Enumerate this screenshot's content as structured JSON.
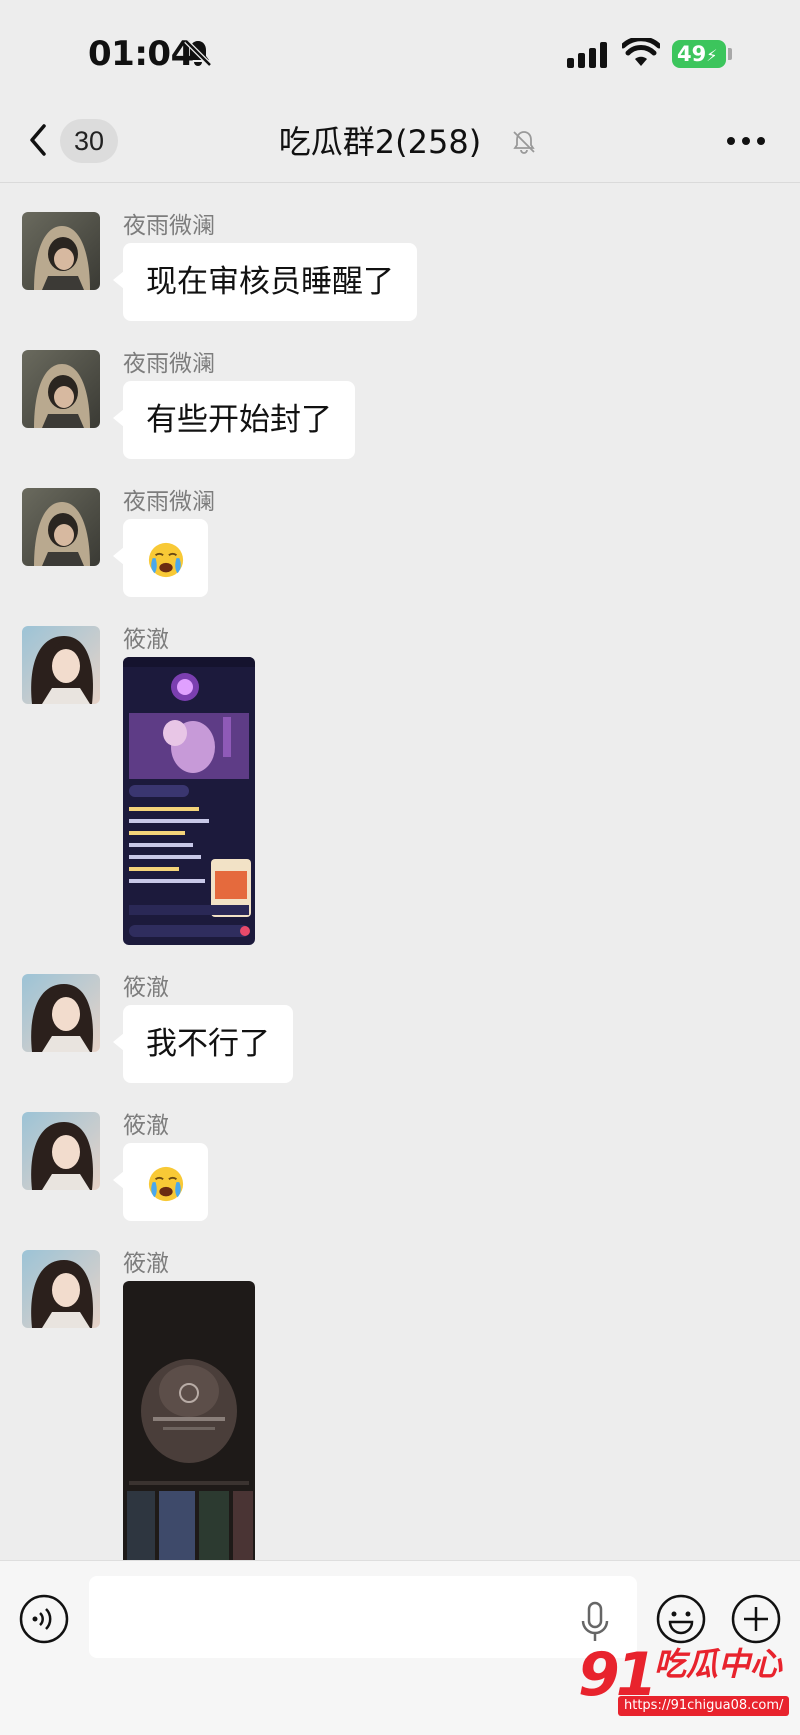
{
  "status_bar": {
    "time": "01:04",
    "battery": "49"
  },
  "header": {
    "back_count": "30",
    "title": "吃瓜群2(258)"
  },
  "messages": [
    {
      "sender": "夜雨微澜",
      "text": "现在审核员睡醒了"
    },
    {
      "sender": "夜雨微澜",
      "text": "有些开始封了"
    },
    {
      "sender": "夜雨微澜",
      "emoji": "😭"
    },
    {
      "sender": "筱澈",
      "image": "screenshot-livestream"
    },
    {
      "sender": "筱澈",
      "text": "我不行了"
    },
    {
      "sender": "筱澈",
      "emoji": "😭"
    },
    {
      "sender": "筱澈",
      "image": "screenshot-dark-video"
    }
  ],
  "input": {
    "placeholder": ""
  },
  "watermark": {
    "number": "91",
    "name": "吃瓜中心",
    "url": "https://91chigua08.com/"
  },
  "colors": {
    "background": "#ededed",
    "bubble": "#ffffff",
    "battery": "#3cc55c",
    "watermark": "#e8232d"
  }
}
